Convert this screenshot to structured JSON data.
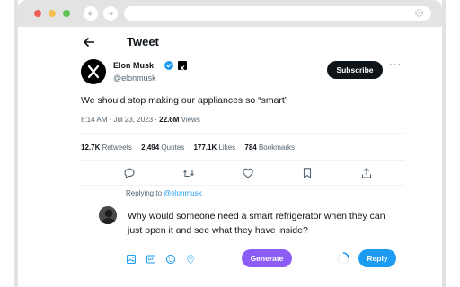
{
  "browser": {
    "window_controls": [
      "close",
      "minimize",
      "maximize"
    ],
    "nav": {
      "back_icon": "arrow-left-icon",
      "forward_icon": "arrow-right-icon"
    },
    "url_bar_icon": "settings-icon"
  },
  "header": {
    "title": "Tweet",
    "back_icon": "arrow-left-icon"
  },
  "author": {
    "name": "Elon Musk",
    "handle": "@elonmusk",
    "verified_icon": "verified-badge-icon",
    "affiliate_icon": "x-logo-icon",
    "subscribe_label": "Subscribe",
    "more_label": "···"
  },
  "tweet": {
    "text": "We should stop making our appliances so “smart”",
    "time": "8:14 AM · Jul 23, 2023 · ",
    "views_count": "22.6M",
    "views_label": " Views"
  },
  "stats": {
    "retweets_count": "12.7K",
    "retweets_label": " Retweets",
    "quotes_count": "2,494",
    "quotes_label": " Quotes",
    "likes_count": "177.1K",
    "likes_label": " Likes",
    "bookmarks_count": "784",
    "bookmarks_label": " Bookmarks"
  },
  "actions": [
    "reply-icon",
    "retweet-icon",
    "like-icon",
    "bookmark-icon",
    "share-icon"
  ],
  "composer": {
    "replying_prefix": "Replying to ",
    "replying_handle": "@elonmusk",
    "text": "Why would someone need a smart refrigerator when they can just open it and see what they have inside?",
    "tools": [
      "image-icon",
      "gif-icon",
      "emoji-icon",
      "location-icon"
    ],
    "generate_label": "Generate",
    "reply_label": "Reply",
    "colors": {
      "generate": "#8b5cf6",
      "reply": "#1d9bf0",
      "subscribe": "#0f1419"
    }
  }
}
